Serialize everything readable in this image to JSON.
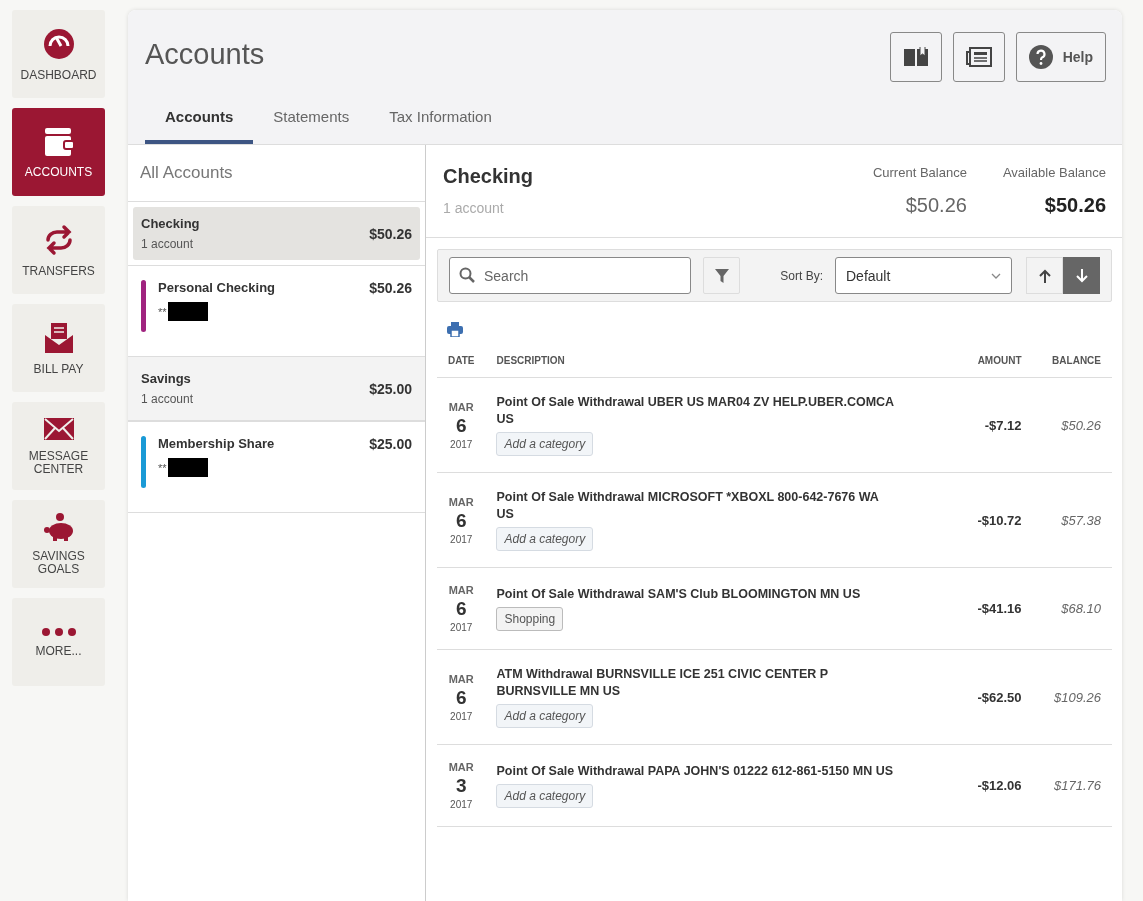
{
  "nav": [
    {
      "kind": "gauge",
      "label": "DASHBOARD",
      "selected": false
    },
    {
      "kind": "wallet",
      "label": "ACCOUNTS",
      "selected": true
    },
    {
      "kind": "transfer",
      "label": "TRANSFERS",
      "selected": false
    },
    {
      "kind": "billpay",
      "label": "BILL PAY",
      "selected": false
    },
    {
      "kind": "mail",
      "label": "MESSAGE CENTER",
      "selected": false
    },
    {
      "kind": "piggy",
      "label": "SAVINGS GOALS",
      "selected": false
    },
    {
      "kind": "dots",
      "label": "MORE...",
      "selected": false
    }
  ],
  "page_title": "Accounts",
  "header_buttons": [
    {
      "kind": "book"
    },
    {
      "kind": "news"
    },
    {
      "kind": "help",
      "label": "Help"
    }
  ],
  "tabs": [
    {
      "label": "Accounts",
      "selected": true
    },
    {
      "label": "Statements",
      "selected": false
    },
    {
      "label": "Tax Information",
      "selected": false
    }
  ],
  "accounts_heading": "All Accounts",
  "account_groups": [
    {
      "name": "Checking",
      "count": "1 account",
      "total": "$50.26",
      "selected": true,
      "accounts": [
        {
          "name": "Personal Checking",
          "number": "**",
          "balance": "$50.26",
          "color": "#a0237f"
        }
      ]
    },
    {
      "name": "Savings",
      "count": "1 account",
      "total": "$25.00",
      "selected": false,
      "accounts": [
        {
          "name": "Membership Share",
          "number": "**",
          "balance": "$25.00",
          "color": "#1a9ad6"
        }
      ]
    }
  ],
  "detail": {
    "title": "Checking",
    "subtitle": "1 account",
    "current_label": "Current Balance",
    "current": "$50.26",
    "available_label": "Available Balance",
    "available": "$50.26"
  },
  "toolbar": {
    "search_placeholder": "Search",
    "sort_label": "Sort By:",
    "sort_value": "Default",
    "order": [
      {
        "kind": "up",
        "selected": false
      },
      {
        "kind": "down",
        "selected": true
      }
    ]
  },
  "table": {
    "columns": [
      "DATE",
      "DESCRIPTION",
      "AMOUNT",
      "BALANCE"
    ],
    "rows": [
      {
        "month": "MAR",
        "day": "6",
        "year": "2017",
        "description": "Point Of Sale Withdrawal UBER US MAR04 ZV HELP.UBER.COMCA US",
        "category": {
          "kind": "prompt",
          "label": "Add a category"
        },
        "amount": "-$7.12",
        "balance": "$50.26"
      },
      {
        "month": "MAR",
        "day": "6",
        "year": "2017",
        "description": "Point Of Sale Withdrawal MICROSOFT *XBOXL 800-642-7676 WA US",
        "category": {
          "kind": "prompt",
          "label": "Add a category"
        },
        "amount": "-$10.72",
        "balance": "$57.38"
      },
      {
        "month": "MAR",
        "day": "6",
        "year": "2017",
        "description": "Point Of Sale Withdrawal SAM'S Club BLOOMINGTON MN US",
        "category": {
          "kind": "tag",
          "label": "Shopping"
        },
        "amount": "-$41.16",
        "balance": "$68.10"
      },
      {
        "month": "MAR",
        "day": "6",
        "year": "2017",
        "description": "ATM Withdrawal BURNSVILLE ICE 251 CIVIC CENTER P BURNSVILLE MN US",
        "category": {
          "kind": "prompt",
          "label": "Add a category"
        },
        "amount": "-$62.50",
        "balance": "$109.26"
      },
      {
        "month": "MAR",
        "day": "3",
        "year": "2017",
        "description": "Point Of Sale Withdrawal PAPA JOHN'S 01222 612-861-5150 MN US",
        "category": {
          "kind": "prompt",
          "label": "Add a category"
        },
        "amount": "-$12.06",
        "balance": "$171.76"
      }
    ]
  }
}
